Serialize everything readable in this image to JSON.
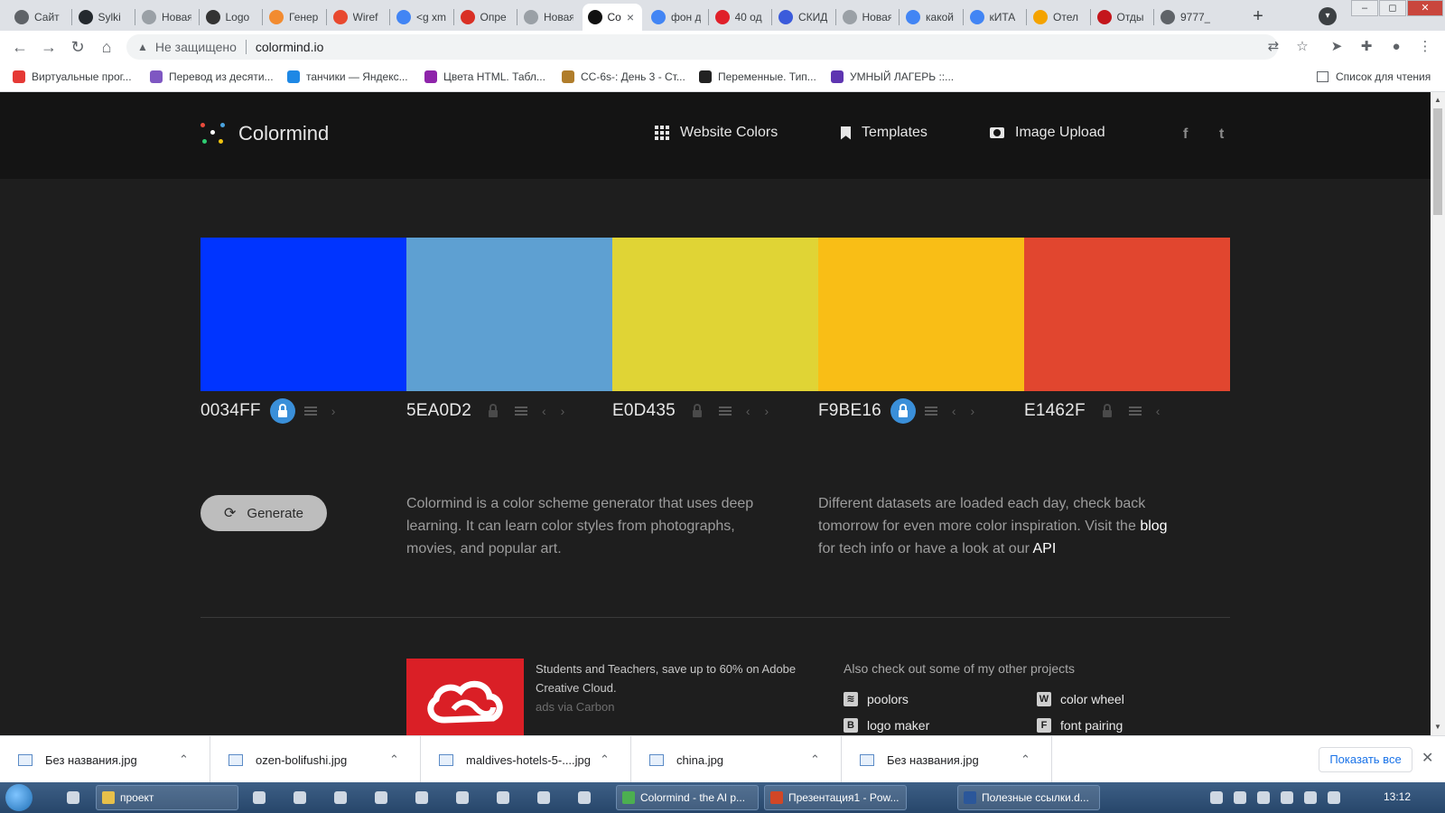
{
  "browser": {
    "tabs": [
      {
        "label": "Сайт",
        "color": "#5f6368"
      },
      {
        "label": "Sylki",
        "color": "#24292e"
      },
      {
        "label": "Новая вкл",
        "color": "#9aa0a6"
      },
      {
        "label": "Logo",
        "color": "#333333"
      },
      {
        "label": "Генер",
        "color": "#f28b30"
      },
      {
        "label": "Wiref",
        "color": "#e8492f"
      },
      {
        "label": "<g xm",
        "color": "#4285f4"
      },
      {
        "label": "Опре",
        "color": "#d93025"
      },
      {
        "label": "Новая вкл",
        "color": "#9aa0a6"
      },
      {
        "label": "Co",
        "color": "#111111"
      },
      {
        "label": "фон д",
        "color": "#4285f4"
      },
      {
        "label": "40 од",
        "color": "#e0202a"
      },
      {
        "label": "СКИД",
        "color": "#3b5bdb"
      },
      {
        "label": "Новая вкл",
        "color": "#9aa0a6"
      },
      {
        "label": "какой",
        "color": "#4285f4"
      },
      {
        "label": "кИТА",
        "color": "#4285f4"
      },
      {
        "label": "Отел",
        "color": "#f4a300"
      },
      {
        "label": "Отды",
        "color": "#c4161c"
      },
      {
        "label": "9777_",
        "color": "#5f6368"
      }
    ],
    "url": "colormind.io",
    "insecure_label": "Не защищено",
    "bookmarks": [
      {
        "label": "Виртуальные прог...",
        "color": "#e53935"
      },
      {
        "label": "Перевод из десяти...",
        "color": "#7e57c2"
      },
      {
        "label": "танчики — Яндекс...",
        "color": "#1e88e5"
      },
      {
        "label": "Цвета HTML. Табл...",
        "color": "#8e24aa"
      },
      {
        "label": "CC-6s-: День 3 - Ст...",
        "color": "#b07d2b"
      },
      {
        "label": "Переменные. Тип...",
        "color": "#222222"
      },
      {
        "label": "УМНЫЙ ЛАГЕРЬ ::...",
        "color": "#5e35b1"
      }
    ],
    "reading_list": "Список для чтения"
  },
  "site": {
    "logo_text": "Colormind",
    "nav": {
      "website_colors": "Website Colors",
      "templates": "Templates",
      "image_upload": "Image Upload"
    },
    "social": {
      "facebook": "f",
      "twitter": "t"
    },
    "palette": [
      {
        "hex": "0034FF",
        "color": "#0034FF",
        "locked": true,
        "prev": false,
        "next": true
      },
      {
        "hex": "5EA0D2",
        "color": "#5EA0D2",
        "locked": false,
        "prev": true,
        "next": true
      },
      {
        "hex": "E0D435",
        "color": "#E0D435",
        "locked": false,
        "prev": true,
        "next": true
      },
      {
        "hex": "F9BE16",
        "color": "#F9BE16",
        "locked": true,
        "prev": true,
        "next": true
      },
      {
        "hex": "E1462F",
        "color": "#E1462F",
        "locked": false,
        "prev": true,
        "next": false
      }
    ],
    "generate_label": "Generate",
    "description": "Colormind is a color scheme generator that uses deep learning. It can learn color styles from photographs, movies, and popular art.",
    "datasets_text": "Different datasets are loaded each day, check back tomorrow for even more color inspiration. Visit the",
    "blog_link": "blog",
    "datasets_middle": "for tech info or have a look at our",
    "api_link": "API",
    "ad": {
      "text": "Students and Teachers, save up to 60% on Adobe Creative Cloud.",
      "via": "ads via Carbon"
    },
    "other_projects_title": "Also check out some of my other projects",
    "projects": [
      "poolors",
      "color wheel",
      "logo maker",
      "font pairing"
    ]
  },
  "downloads": {
    "items": [
      "Без названия.jpg",
      "ozen-bolifushi.jpg",
      "maldives-hotels-5-....jpg",
      "china.jpg",
      "Без названия.jpg"
    ],
    "show_all": "Показать все"
  },
  "taskbar": {
    "items": [
      {
        "label": "проект",
        "color": "#e8c04a"
      },
      {
        "label": "Colormind - the AI p...",
        "color": "#4caf50"
      },
      {
        "label": "Презентация1 - Pow...",
        "color": "#d24726"
      },
      {
        "label": "Полезные ссылки.d...",
        "color": "#2b579a"
      }
    ],
    "time": "13:12"
  }
}
